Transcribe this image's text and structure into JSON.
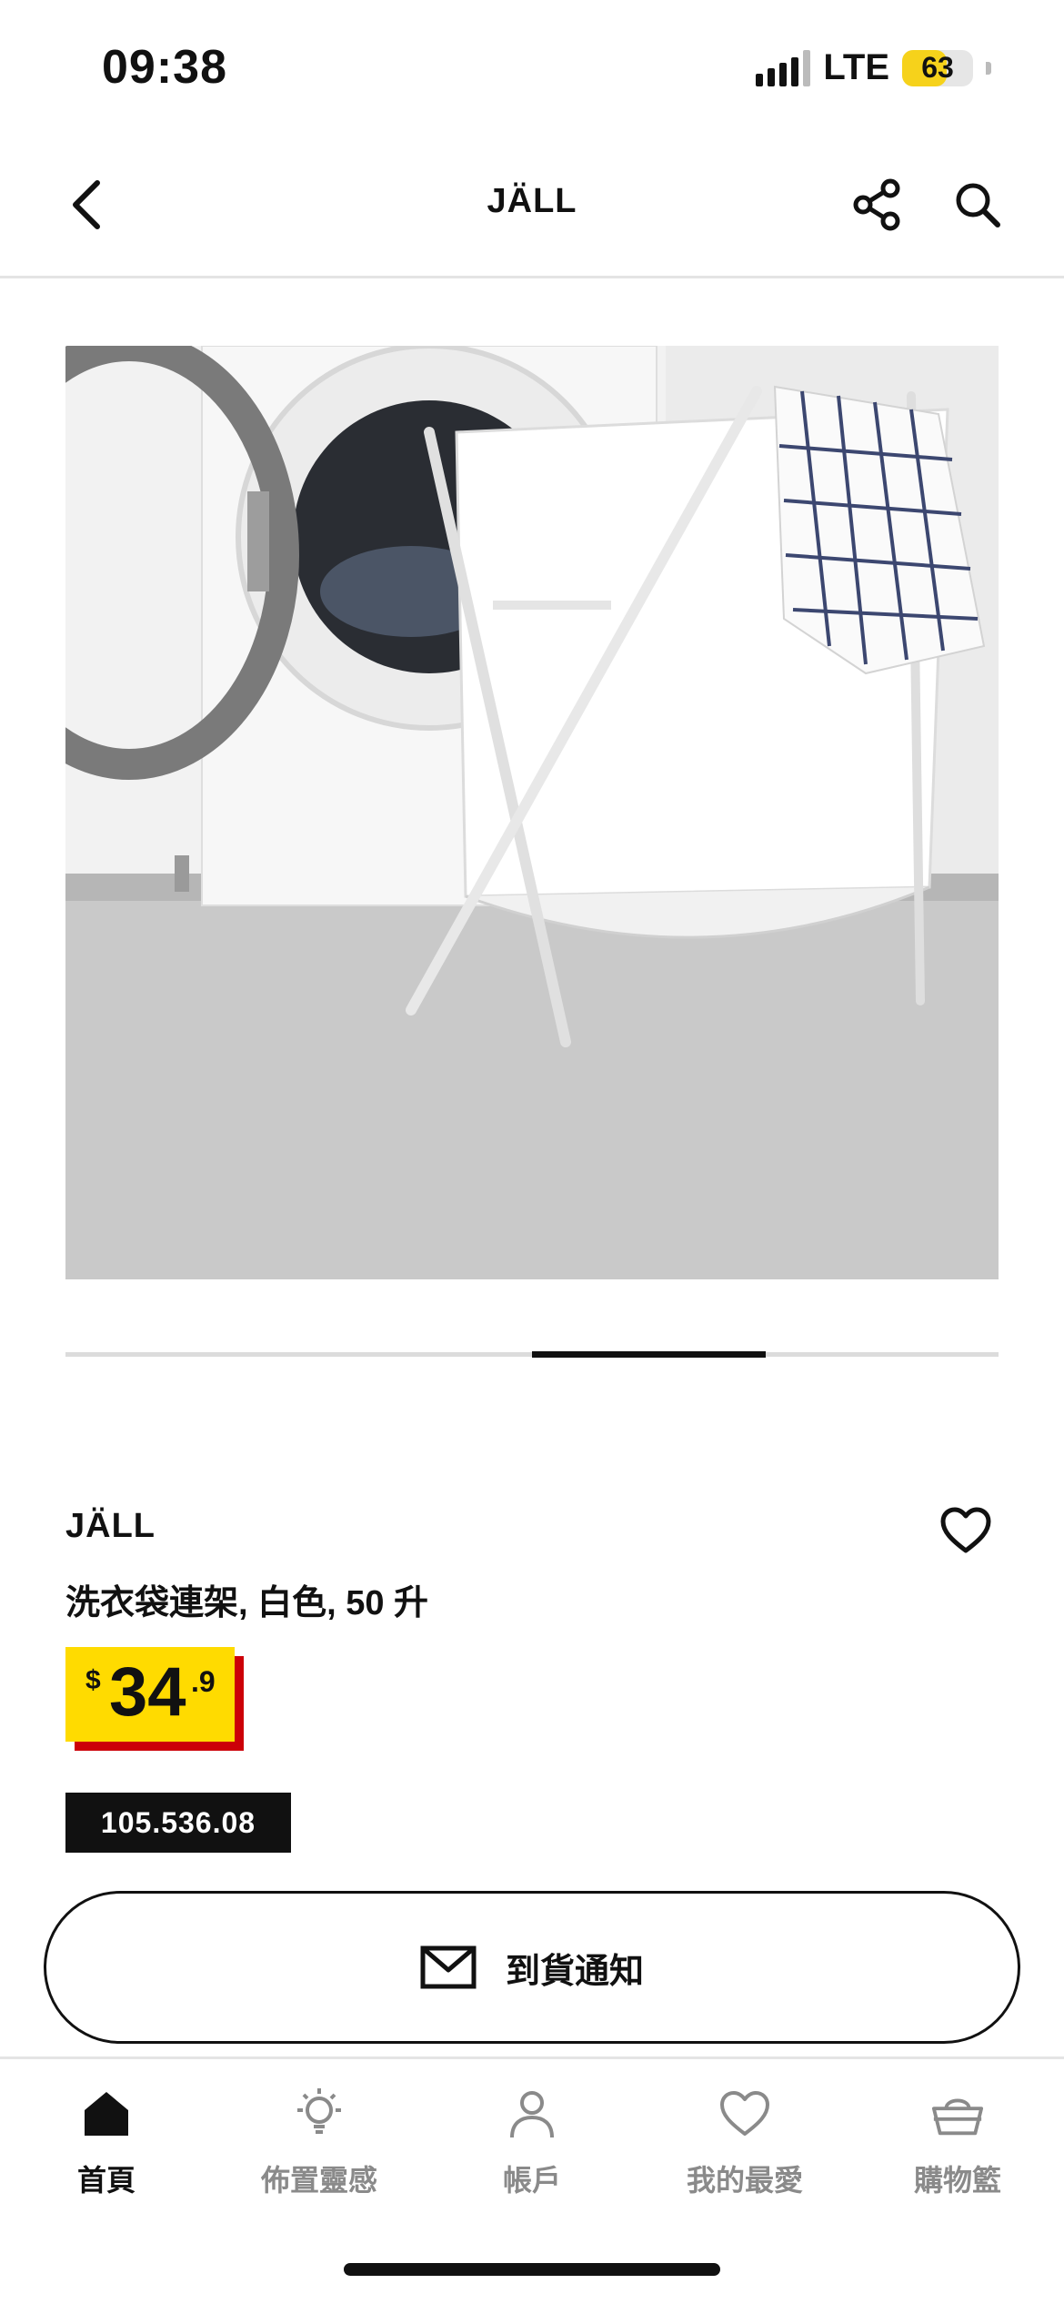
{
  "status_bar": {
    "time": "09:38",
    "network": "LTE",
    "battery": "63",
    "battery_level_percent": 63
  },
  "header": {
    "title": "JÄLL",
    "icons": [
      "back-chevron-icon",
      "share-icon",
      "search-icon"
    ]
  },
  "product": {
    "image_alt": "JÄLL laundry bag with stand next to washing machine",
    "carousel_position": {
      "index": 3,
      "count": 4
    },
    "name": "JÄLL",
    "description": "洗衣袋連架, 白色, 50 升",
    "price": {
      "currency": "$",
      "integer": "34",
      "decimal": ".9"
    },
    "article_number": "105.536.08"
  },
  "actions": {
    "notify_label": "到貨通知",
    "notify_icon": "mail-icon",
    "favorite_icon": "heart-icon"
  },
  "bottom_nav": {
    "items": [
      {
        "label": "首頁",
        "icon": "home-icon",
        "active": true
      },
      {
        "label": "佈置靈感",
        "icon": "lightbulb-icon",
        "active": false
      },
      {
        "label": "帳戶",
        "icon": "person-icon",
        "active": false
      },
      {
        "label": "我的最愛",
        "icon": "heart-icon",
        "active": false
      },
      {
        "label": "購物籃",
        "icon": "basket-icon",
        "active": false
      }
    ]
  },
  "colors": {
    "price_yellow": "#ffdb00",
    "price_red": "#cc0008",
    "battery_yellow": "#f6d21b",
    "text": "#111111",
    "muted": "#8a8a8a"
  }
}
